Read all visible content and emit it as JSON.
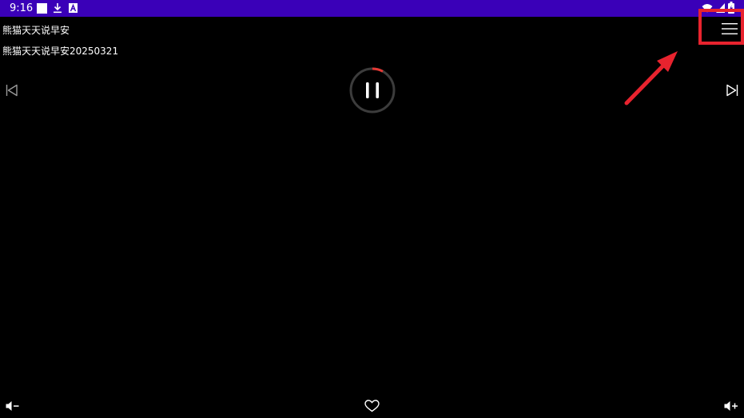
{
  "status_bar": {
    "time": "9:16",
    "background": "#3a00b8"
  },
  "player": {
    "title": "熊猫天天说早安",
    "subtitle": "熊猫天天说早安20250321",
    "progress_fraction": 0.08,
    "playback_state": "playing"
  },
  "icons": {
    "menu": "menu-icon",
    "prev": "skip-previous-icon",
    "next": "skip-next-icon",
    "pause": "pause-icon",
    "favorite": "heart-icon",
    "volume_down": "volume-down-icon",
    "volume_up": "volume-up-icon"
  },
  "annotation": {
    "highlight_color": "#e8232e",
    "arrow_color": "#e8232e"
  },
  "colors": {
    "progress_track": "#3c3c3c",
    "progress_fill": "#e53935",
    "foreground": "#ffffff"
  }
}
